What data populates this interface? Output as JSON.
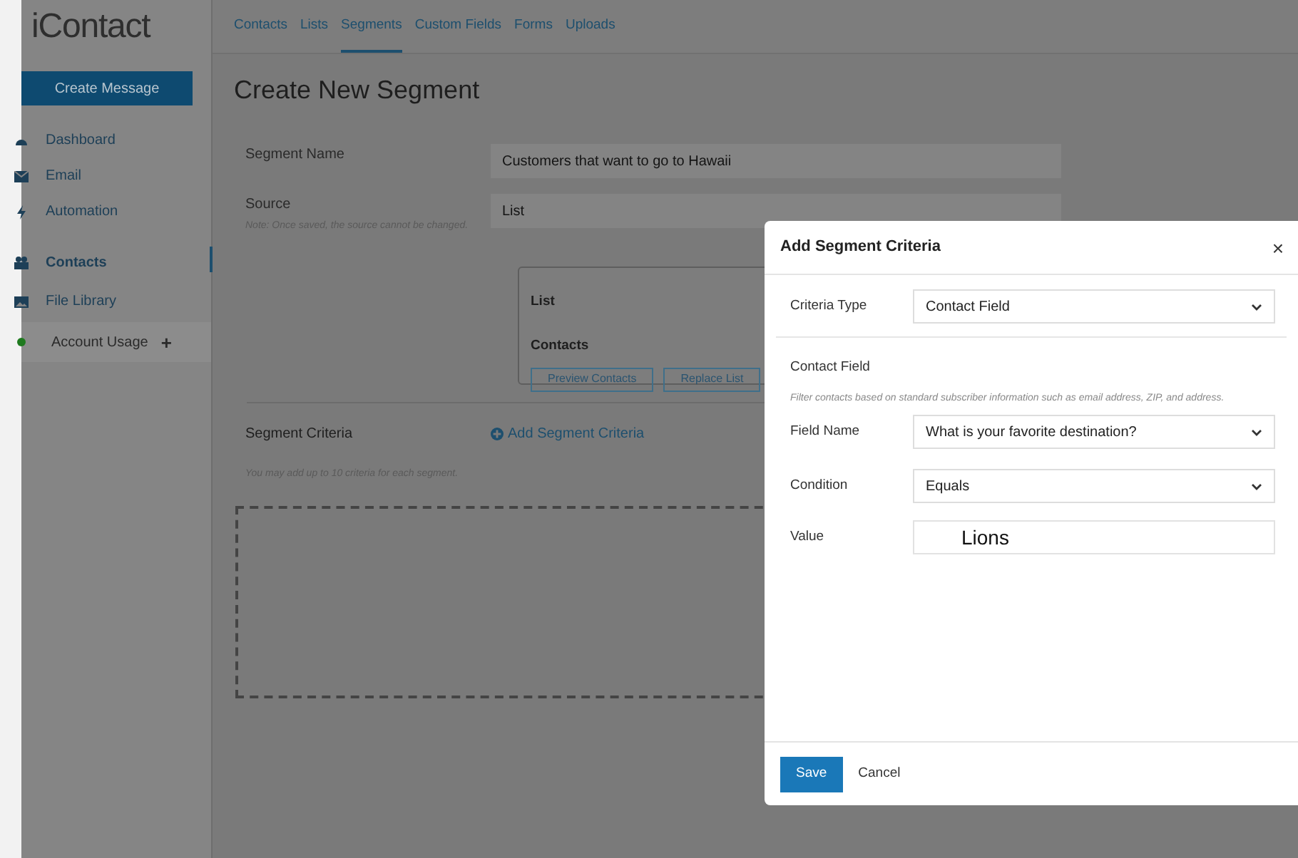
{
  "logo": "iContact",
  "tabs": [
    {
      "label": "Contacts",
      "selected": false
    },
    {
      "label": "Lists",
      "selected": false
    },
    {
      "label": "Segments",
      "selected": true
    },
    {
      "label": "Custom Fields",
      "selected": false
    },
    {
      "label": "Forms",
      "selected": false
    },
    {
      "label": "Uploads",
      "selected": false
    }
  ],
  "sidebar": {
    "create_button": "Create Message",
    "items": [
      {
        "label": "Dashboard",
        "selected": false
      },
      {
        "label": "Email",
        "selected": false
      },
      {
        "label": "Automation",
        "selected": false
      },
      {
        "label": "Contacts",
        "selected": true
      },
      {
        "label": "File Library",
        "selected": false
      }
    ],
    "account_usage": "Account Usage",
    "account_plus": "+"
  },
  "page_title": "Create New Segment",
  "segment_name": {
    "label": "Segment Name",
    "value": "Customers that want to go to Hawaii"
  },
  "source": {
    "label": "Source",
    "note": "Note: Once saved, the source cannot be changed.",
    "value": "List"
  },
  "list_card": {
    "list_label": "List",
    "contacts_label": "Contacts",
    "buttons": [
      "Preview Contacts",
      "Replace List"
    ]
  },
  "criteria": {
    "label": "Segment Criteria",
    "add_link": "Add Segment Criteria",
    "hint": "You may add up to 10 criteria for each segment."
  },
  "modal": {
    "title": "Add Segment Criteria",
    "close": "×",
    "criteria_type": {
      "label": "Criteria Type",
      "value": "Contact Field"
    },
    "section_title": "Contact Field",
    "section_note": "Filter contacts based on standard subscriber information such as email address, ZIP, and address.",
    "field_name": {
      "label": "Field Name",
      "value": "What is your favorite destination?"
    },
    "condition": {
      "label": "Condition",
      "value": "Equals"
    },
    "value": {
      "label": "Value",
      "value": "Lions"
    },
    "save": "Save",
    "cancel": "Cancel"
  }
}
